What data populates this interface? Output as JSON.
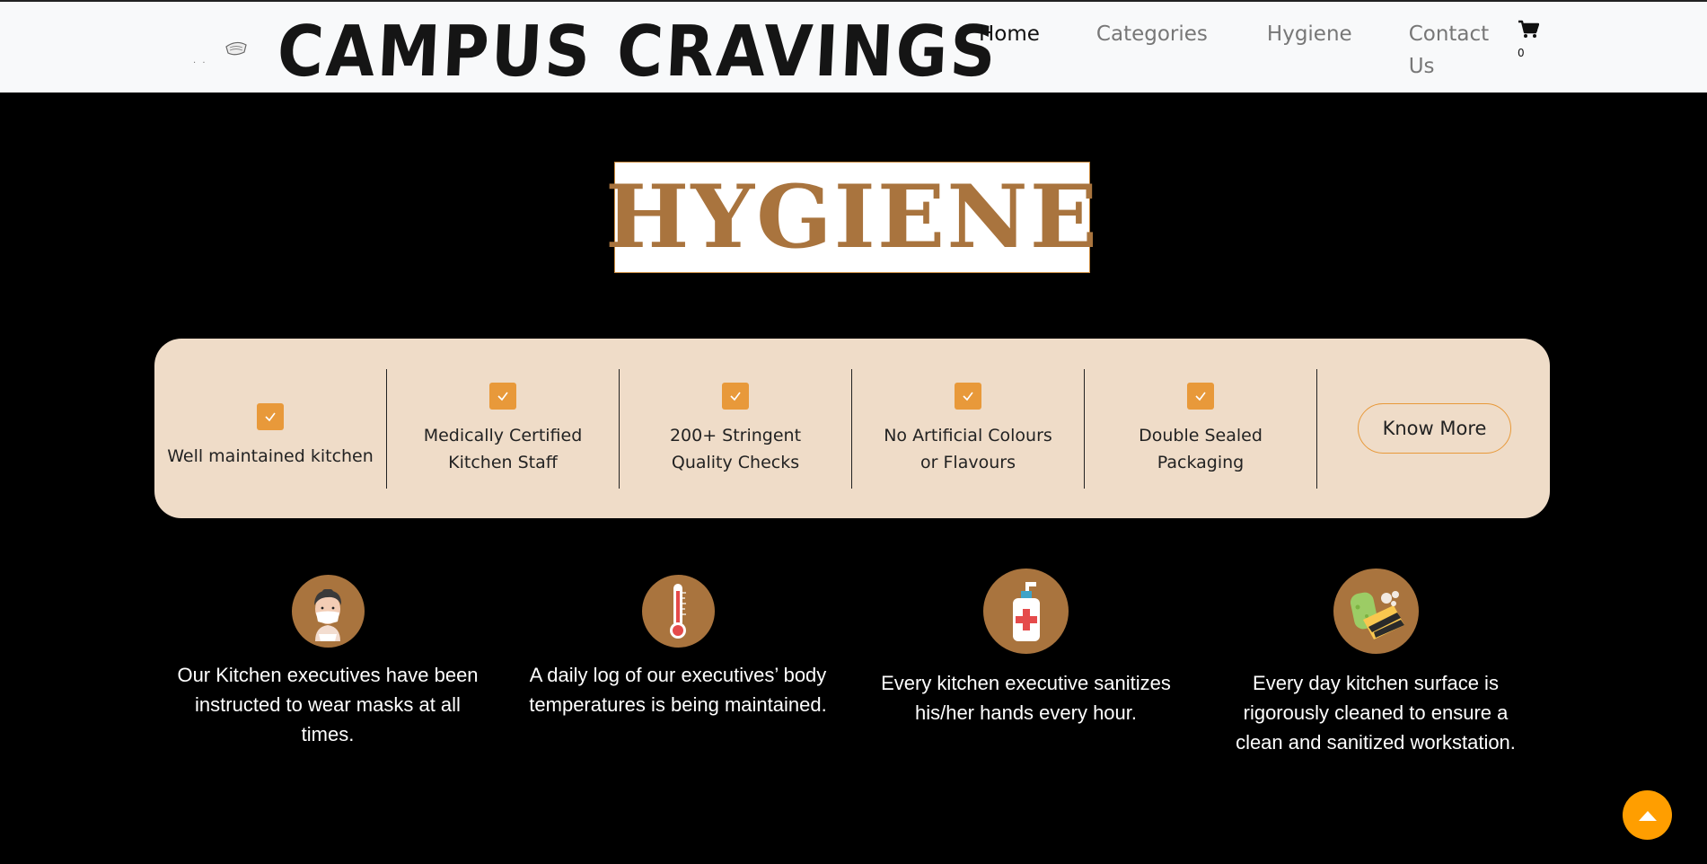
{
  "navbar": {
    "brand": "CAMPUS CRAVINGS",
    "links": [
      {
        "label": "Home",
        "active": true
      },
      {
        "label": "Categories",
        "active": false
      },
      {
        "label": "Hygiene",
        "active": false
      },
      {
        "label": "Contact Us",
        "active": false
      }
    ],
    "cart_count": "0",
    "cart_icon": "shopping-cart-icon"
  },
  "hero": {
    "heading": "HYGIENE"
  },
  "features": {
    "items": [
      {
        "label": "Well maintained kitchen",
        "icon": "check-icon"
      },
      {
        "label": "Medically Certified Kitchen Staff",
        "icon": "check-icon"
      },
      {
        "label": "200+ Stringent Quality Checks",
        "icon": "check-icon"
      },
      {
        "label": "No Artificial Colours or Flavours",
        "icon": "check-icon"
      },
      {
        "label": "Double Sealed Packaging",
        "icon": "check-icon"
      }
    ],
    "button_label": "Know More"
  },
  "info_cards": [
    {
      "text": "Our Kitchen executives have been instructed to wear masks at all times.",
      "icon": "masked-chef-icon"
    },
    {
      "text": "A daily log of our executives’ body temperatures is being maintained.",
      "icon": "thermometer-icon"
    },
    {
      "text": "Every kitchen executive sanitizes his/her hands every hour.",
      "icon": "sanitizer-bottle-icon"
    },
    {
      "text": "Every day kitchen surface is rigorously cleaned to ensure a clean and sanitized workstation.",
      "icon": "sponge-icon"
    }
  ],
  "colors": {
    "accent": "#e8993a",
    "heading": "#a9743e",
    "panel": "#efdcc8",
    "scroll_button": "#ff9e00"
  }
}
